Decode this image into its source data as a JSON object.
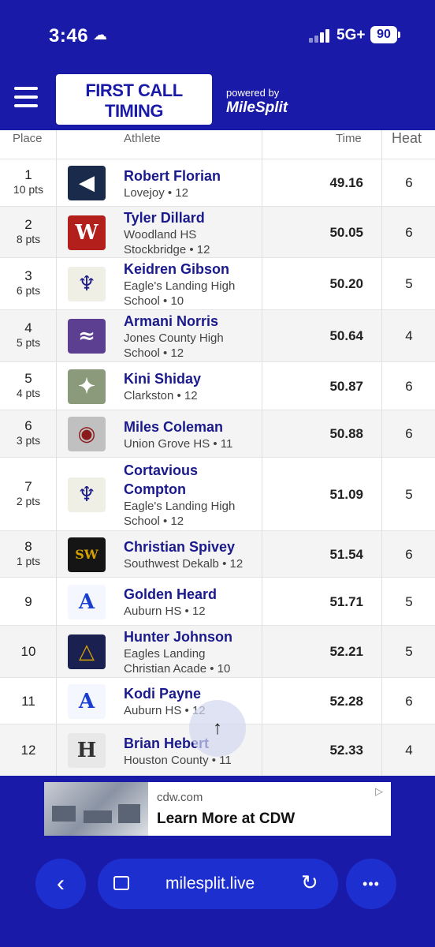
{
  "status_bar": {
    "time": "3:46",
    "network": "5G+",
    "battery": "90"
  },
  "header": {
    "logo_line1": "FIRST CALL",
    "logo_line2": "TIMING",
    "powered_by": "powered by",
    "brand": "MileSplit"
  },
  "table": {
    "columns": {
      "place": "Place",
      "athlete": "Athlete",
      "time": "Time",
      "heat": "Heat"
    },
    "rows": [
      {
        "place": "1",
        "pts": "10 pts",
        "name_lines": [
          "Robert Florian"
        ],
        "school_lines": [
          "Lovejoy • 12"
        ],
        "time": "49.16",
        "heat": "6"
      },
      {
        "place": "2",
        "pts": "8 pts",
        "name_lines": [
          "Tyler Dillard"
        ],
        "school_lines": [
          "Woodland HS",
          "Stockbridge • 12"
        ],
        "time": "50.05",
        "heat": "6"
      },
      {
        "place": "3",
        "pts": "6 pts",
        "name_lines": [
          "Keidren Gibson"
        ],
        "school_lines": [
          "Eagle's Landing High",
          "School • 10"
        ],
        "time": "50.20",
        "heat": "5"
      },
      {
        "place": "4",
        "pts": "5 pts",
        "name_lines": [
          "Armani Norris"
        ],
        "school_lines": [
          "Jones County High",
          "School • 12"
        ],
        "time": "50.64",
        "heat": "4"
      },
      {
        "place": "5",
        "pts": "4 pts",
        "name_lines": [
          "Kini Shiday"
        ],
        "school_lines": [
          "Clarkston • 12"
        ],
        "time": "50.87",
        "heat": "6"
      },
      {
        "place": "6",
        "pts": "3 pts",
        "name_lines": [
          "Miles Coleman"
        ],
        "school_lines": [
          "Union Grove HS • 11"
        ],
        "time": "50.88",
        "heat": "6"
      },
      {
        "place": "7",
        "pts": "2 pts",
        "name_lines": [
          "Cortavious",
          "Compton"
        ],
        "school_lines": [
          "Eagle's Landing High",
          "School • 12"
        ],
        "time": "51.09",
        "heat": "5"
      },
      {
        "place": "8",
        "pts": "1 pts",
        "name_lines": [
          "Christian Spivey"
        ],
        "school_lines": [
          "Southwest Dekalb • 12"
        ],
        "time": "51.54",
        "heat": "6"
      },
      {
        "place": "9",
        "pts": "",
        "name_lines": [
          "Golden Heard"
        ],
        "school_lines": [
          "Auburn HS • 12"
        ],
        "time": "51.71",
        "heat": "5"
      },
      {
        "place": "10",
        "pts": "",
        "name_lines": [
          "Hunter Johnson"
        ],
        "school_lines": [
          "Eagles Landing",
          "Christian Acade • 10"
        ],
        "time": "52.21",
        "heat": "5"
      },
      {
        "place": "11",
        "pts": "",
        "name_lines": [
          "Kodi Payne"
        ],
        "school_lines": [
          "Auburn HS • 12"
        ],
        "time": "52.28",
        "heat": "6"
      },
      {
        "place": "12",
        "pts": "",
        "name_lines": [
          "Brian Hebert"
        ],
        "school_lines": [
          "Houston County • 11"
        ],
        "time": "52.33",
        "heat": "4"
      }
    ]
  },
  "scroll_top": {
    "icon": "arrow-up-icon",
    "glyph": "↑"
  },
  "ad": {
    "domain": "cdw.com",
    "cta": "Learn More at CDW"
  },
  "browser_bar": {
    "url": "milesplit.live",
    "back_glyph": "‹",
    "more_glyph": "•••",
    "reload_glyph": "↻"
  },
  "colors": {
    "brand_blue": "#1a1aa8",
    "button_blue": "#1e2fd0",
    "name_blue": "#1a1a8c"
  }
}
